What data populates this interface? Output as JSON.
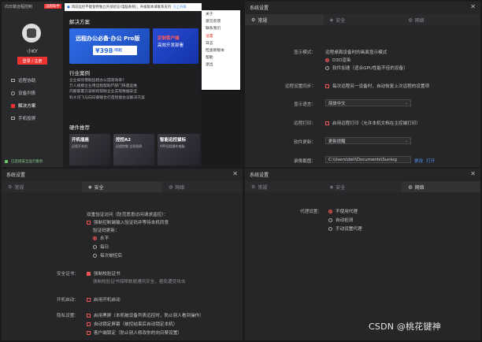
{
  "app": {
    "title": "向日葵远程控制",
    "tag": "远程助手",
    "notice": "目前远控不能使用独立外部验证(电脑系统)，升级版本请联系支持",
    "notice_link": "马上升级",
    "username": "小KY",
    "login_button": "登录 / 注册",
    "nav": [
      "远程协助",
      "设备列表",
      "解决方案",
      "手机投屏"
    ],
    "status": "已连接安全运行服务",
    "section1": "解决方案",
    "banner1_title": "远程办公必备·办公 Pro版",
    "banner1_price": "¥398",
    "banner1_unit": "/年起",
    "banner2_title": "定制客户端",
    "banner2_sub": "高效开发部署",
    "section2": "行业案例",
    "case_text": "企业如何借助远程办公提高效率？\n万人规模企业用远程帮助IT部门快速运维\n内部部署方案如何帮助企业实现数据安全\n科大讯飞与向日葵联合打造智能会议解决方案",
    "section3": "硬件推荐",
    "cards": [
      "开机插座",
      "控控A2",
      "智能远控鼠标"
    ],
    "card_subs": [
      "远程开关机",
      "远程控制  全局投屏",
      "APP远程操作电脑"
    ]
  },
  "menu": {
    "items": [
      "关于",
      "意见反馈",
      "联系我们",
      "设置",
      "日志",
      "检查新版本",
      "帮助",
      "退出"
    ]
  },
  "settings_general": {
    "title": "系统设置",
    "tabs": [
      "常规",
      "安全",
      "网络"
    ],
    "display_label": "显示模式：",
    "display_note": "远程桌面设备时的画面显示模式",
    "display_opt1": "D3D渲染",
    "display_opt2": "软件加速（适合GPU性能不佳的设备）",
    "sync_label": "远程设置同步：",
    "sync_opt": "每次远程另一设备时，自动恢复上次远程的设置项",
    "lang_label": "显示语言：",
    "lang_value": "简体中文",
    "print_label": "远程打印：",
    "print_opt": "启用远程打印（允许本机文档在主控端打印）",
    "update_label": "软件更新：",
    "update_value": "更新提醒",
    "path_label": "录像截图：",
    "path_value": "C:\\Users\\dell\\Documents\\Sunlog",
    "path_change": "更改",
    "path_open": "打开"
  },
  "settings_security": {
    "title": "系统设置",
    "tabs": [
      "常规",
      "安全",
      "网络"
    ],
    "dual_title": "双重验证访问（防范恶意访问请求盗控）：",
    "dual_opt": "强制控制端输入验证码并等待本机同意",
    "verify_label": "验证码更新：",
    "verify_opts": [
      "永不",
      "每日",
      "每次被控后"
    ],
    "cert_label": "安全证书：",
    "cert_opt": "强制校验证书",
    "cert_note": "强制校验证书保障数据通讯安全，避免遭受攻击",
    "boot_label": "开机启动：",
    "boot_opt": "启用开机启动",
    "privacy_label": "隐私设置：",
    "privacy_opts": [
      "启用黑屏（本机被设备列表远控时，防止别人看到操作）",
      "自动锁定屏幕（被控结束后自动锁定本机）",
      "客户端锁定（防止别人修改你的向日葵设置）"
    ]
  },
  "settings_network": {
    "title": "系统设置",
    "tabs": [
      "常规",
      "安全",
      "网络"
    ],
    "proxy_label": "代理设置：",
    "proxy_opts": [
      "不使用代理",
      "自动检测",
      "手动设置代理"
    ]
  },
  "watermark": "CSDN @桃花键神",
  "colors": {
    "accent": "#e55353",
    "link": "#4f8ff0",
    "background": "#262628"
  }
}
